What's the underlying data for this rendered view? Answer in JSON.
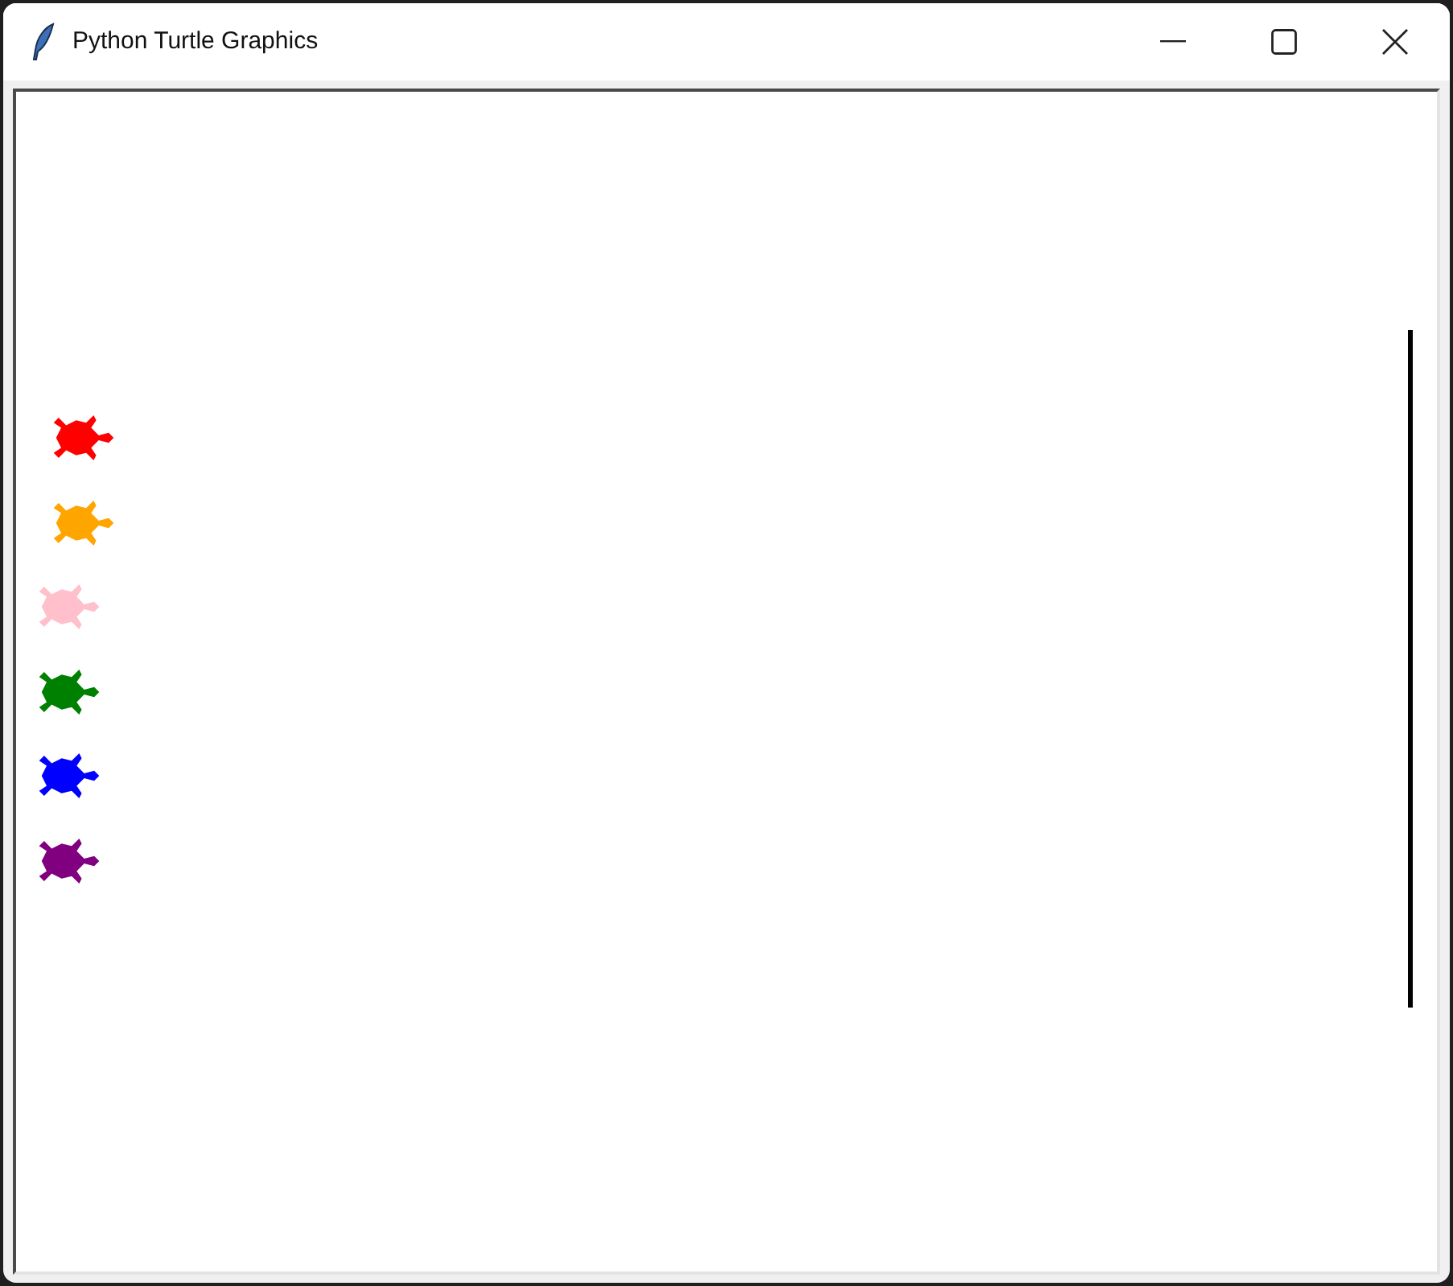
{
  "window": {
    "title": "Python Turtle Graphics"
  },
  "canvas": {
    "turtles": [
      {
        "color": "#ff0000"
      },
      {
        "color": "#ffa500"
      },
      {
        "color": "#ffc0cb"
      },
      {
        "color": "#008000"
      },
      {
        "color": "#0000ff"
      },
      {
        "color": "#800080"
      }
    ]
  }
}
